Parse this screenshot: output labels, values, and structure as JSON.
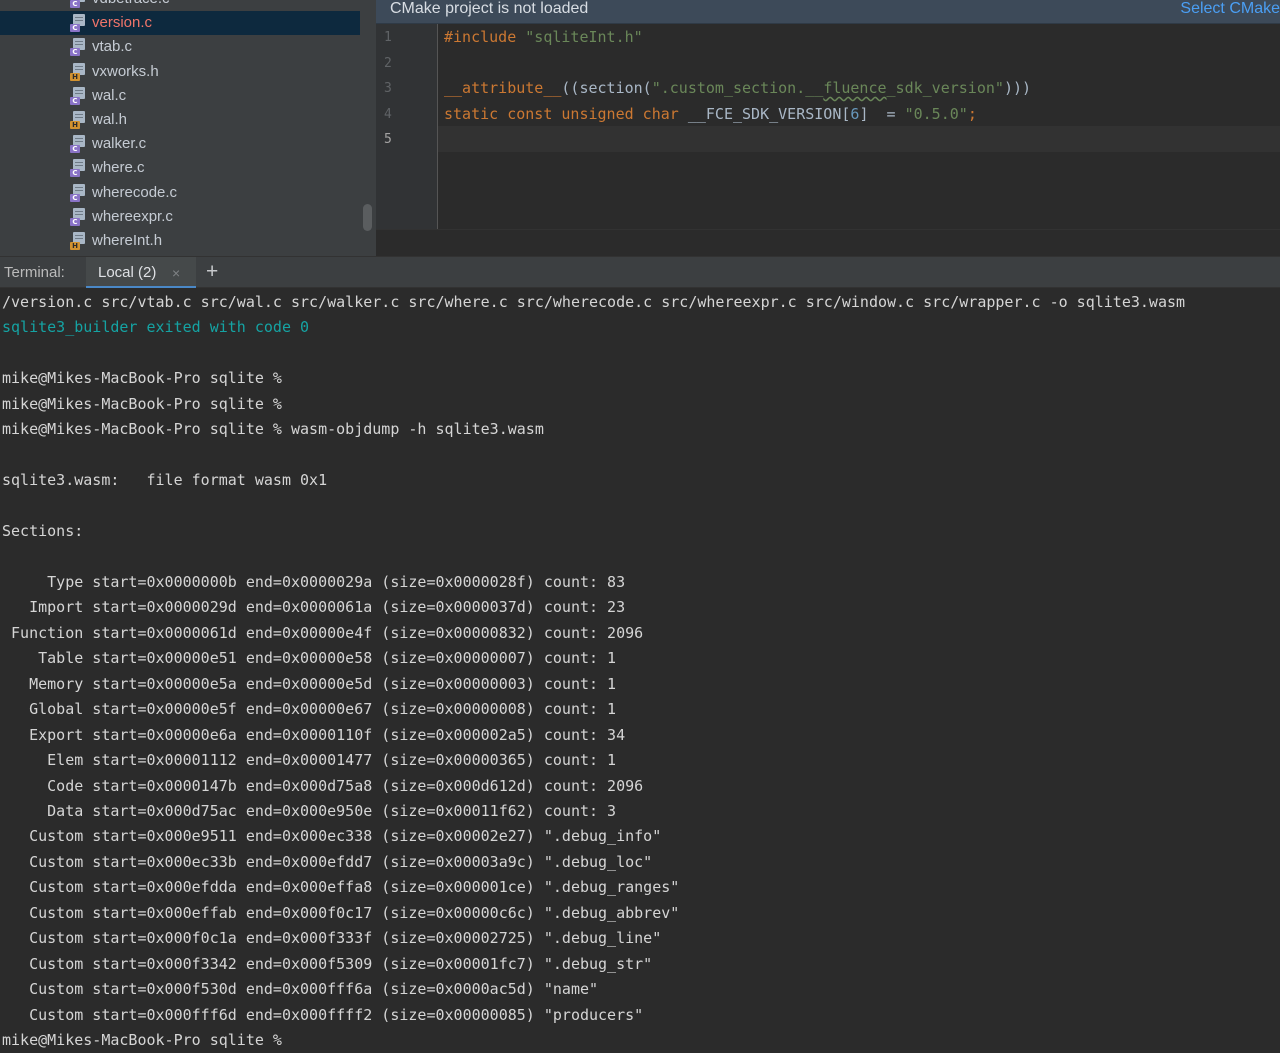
{
  "project_tree": {
    "files": [
      {
        "name": "vdbetrace.c",
        "type": "c",
        "selected": false
      },
      {
        "name": "version.c",
        "type": "c",
        "selected": true
      },
      {
        "name": "vtab.c",
        "type": "c",
        "selected": false
      },
      {
        "name": "vxworks.h",
        "type": "h",
        "selected": false
      },
      {
        "name": "wal.c",
        "type": "c",
        "selected": false
      },
      {
        "name": "wal.h",
        "type": "h",
        "selected": false
      },
      {
        "name": "walker.c",
        "type": "c",
        "selected": false
      },
      {
        "name": "where.c",
        "type": "c",
        "selected": false
      },
      {
        "name": "wherecode.c",
        "type": "c",
        "selected": false
      },
      {
        "name": "whereexpr.c",
        "type": "c",
        "selected": false
      },
      {
        "name": "whereInt.h",
        "type": "h",
        "selected": false
      }
    ]
  },
  "editor": {
    "notice": {
      "text": "CMake project is not loaded",
      "action": "Select CMake"
    },
    "current_line": 5,
    "lines": [
      {
        "number": "1",
        "tokens": [
          {
            "t": "#include ",
            "c": "kw"
          },
          {
            "t": "\"sqliteInt.h\"",
            "c": "str"
          }
        ]
      },
      {
        "number": "2",
        "tokens": []
      },
      {
        "number": "3",
        "tokens": [
          {
            "t": "__attribute__",
            "c": "kw"
          },
          {
            "t": "((section(",
            "c": ""
          },
          {
            "t": "\".custom_section.__",
            "c": "str"
          },
          {
            "t": "fluence",
            "c": "str wavy"
          },
          {
            "t": "_sdk_version\"",
            "c": "str"
          },
          {
            "t": ")))",
            "c": ""
          }
        ]
      },
      {
        "number": "4",
        "tokens": [
          {
            "t": "static const unsigned char ",
            "c": "kw"
          },
          {
            "t": "__FCE_SDK_VERSION[",
            "c": ""
          },
          {
            "t": "6",
            "c": "num"
          },
          {
            "t": "]  = ",
            "c": ""
          },
          {
            "t": "\"0.5.0\"",
            "c": "str"
          },
          {
            "t": ";",
            "c": "kw"
          }
        ]
      },
      {
        "number": "5",
        "tokens": []
      }
    ]
  },
  "terminal": {
    "title": "Terminal:",
    "tab_label": "Local (2)",
    "close_glyph": "×",
    "add_glyph": "+",
    "lines": [
      {
        "text": "/version.c src/vtab.c src/wal.c src/walker.c src/where.c src/wherecode.c src/whereexpr.c src/window.c src/wrapper.c -o sqlite3.wasm",
        "style": ""
      },
      {
        "text": "sqlite3_builder exited with code 0",
        "style": "info"
      },
      {
        "text": "",
        "style": ""
      },
      {
        "text": "mike@Mikes-MacBook-Pro sqlite %",
        "style": ""
      },
      {
        "text": "mike@Mikes-MacBook-Pro sqlite %",
        "style": ""
      },
      {
        "text": "mike@Mikes-MacBook-Pro sqlite % wasm-objdump -h sqlite3.wasm",
        "style": ""
      },
      {
        "text": "",
        "style": ""
      },
      {
        "text": "sqlite3.wasm:   file format wasm 0x1",
        "style": ""
      },
      {
        "text": "",
        "style": ""
      },
      {
        "text": "Sections:",
        "style": ""
      },
      {
        "text": "",
        "style": ""
      },
      {
        "text": "     Type start=0x0000000b end=0x0000029a (size=0x0000028f) count: 83",
        "style": ""
      },
      {
        "text": "   Import start=0x0000029d end=0x0000061a (size=0x0000037d) count: 23",
        "style": ""
      },
      {
        "text": " Function start=0x0000061d end=0x00000e4f (size=0x00000832) count: 2096",
        "style": ""
      },
      {
        "text": "    Table start=0x00000e51 end=0x00000e58 (size=0x00000007) count: 1",
        "style": ""
      },
      {
        "text": "   Memory start=0x00000e5a end=0x00000e5d (size=0x00000003) count: 1",
        "style": ""
      },
      {
        "text": "   Global start=0x00000e5f end=0x00000e67 (size=0x00000008) count: 1",
        "style": ""
      },
      {
        "text": "   Export start=0x00000e6a end=0x0000110f (size=0x000002a5) count: 34",
        "style": ""
      },
      {
        "text": "     Elem start=0x00001112 end=0x00001477 (size=0x00000365) count: 1",
        "style": ""
      },
      {
        "text": "     Code start=0x0000147b end=0x000d75a8 (size=0x000d612d) count: 2096",
        "style": ""
      },
      {
        "text": "     Data start=0x000d75ac end=0x000e950e (size=0x00011f62) count: 3",
        "style": ""
      },
      {
        "text": "   Custom start=0x000e9511 end=0x000ec338 (size=0x00002e27) \".debug_info\"",
        "style": ""
      },
      {
        "text": "   Custom start=0x000ec33b end=0x000efdd7 (size=0x00003a9c) \".debug_loc\"",
        "style": ""
      },
      {
        "text": "   Custom start=0x000efdda end=0x000effa8 (size=0x000001ce) \".debug_ranges\"",
        "style": ""
      },
      {
        "text": "   Custom start=0x000effab end=0x000f0c17 (size=0x00000c6c) \".debug_abbrev\"",
        "style": ""
      },
      {
        "text": "   Custom start=0x000f0c1a end=0x000f333f (size=0x00002725) \".debug_line\"",
        "style": ""
      },
      {
        "text": "   Custom start=0x000f3342 end=0x000f5309 (size=0x00001fc7) \".debug_str\"",
        "style": ""
      },
      {
        "text": "   Custom start=0x000f530d end=0x000fff6a (size=0x0000ac5d) \"name\"",
        "style": ""
      },
      {
        "text": "   Custom start=0x000fff6d end=0x000ffff2 (size=0x00000085) \"producers\"",
        "style": ""
      },
      {
        "text": "mike@Mikes-MacBook-Pro sqlite %",
        "style": ""
      }
    ]
  }
}
